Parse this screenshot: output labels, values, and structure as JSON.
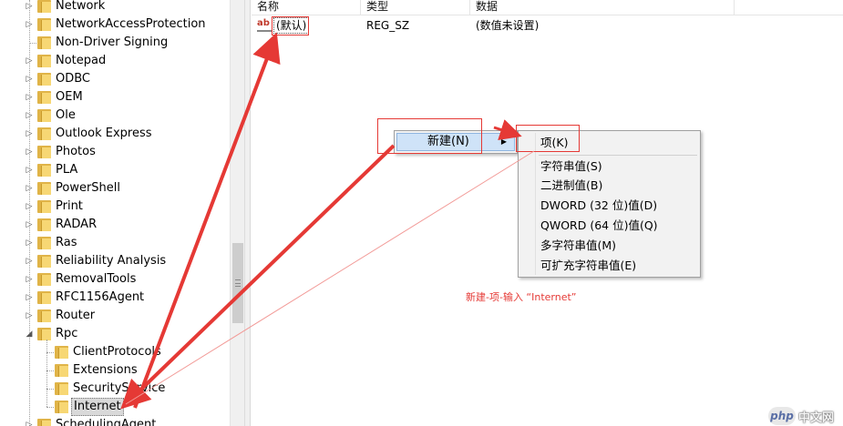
{
  "tree": {
    "items": [
      {
        "label": "Network",
        "expander": "▷",
        "level": 0
      },
      {
        "label": "NetworkAccessProtection",
        "expander": "▷",
        "level": 0
      },
      {
        "label": "Non-Driver Signing",
        "expander": "",
        "level": 0
      },
      {
        "label": "Notepad",
        "expander": "▷",
        "level": 0
      },
      {
        "label": "ODBC",
        "expander": "▷",
        "level": 0
      },
      {
        "label": "OEM",
        "expander": "▷",
        "level": 0
      },
      {
        "label": "Ole",
        "expander": "▷",
        "level": 0
      },
      {
        "label": "Outlook Express",
        "expander": "▷",
        "level": 0
      },
      {
        "label": "Photos",
        "expander": "▷",
        "level": 0
      },
      {
        "label": "PLA",
        "expander": "▷",
        "level": 0
      },
      {
        "label": "PowerShell",
        "expander": "▷",
        "level": 0
      },
      {
        "label": "Print",
        "expander": "▷",
        "level": 0
      },
      {
        "label": "RADAR",
        "expander": "▷",
        "level": 0
      },
      {
        "label": "Ras",
        "expander": "▷",
        "level": 0
      },
      {
        "label": "Reliability Analysis",
        "expander": "▷",
        "level": 0
      },
      {
        "label": "RemovalTools",
        "expander": "▷",
        "level": 0
      },
      {
        "label": "RFC1156Agent",
        "expander": "▷",
        "level": 0
      },
      {
        "label": "Router",
        "expander": "▷",
        "level": 0
      },
      {
        "label": "Rpc",
        "expander": "◢",
        "level": 0
      },
      {
        "label": "ClientProtocols",
        "expander": "",
        "level": 1
      },
      {
        "label": "Extensions",
        "expander": "",
        "level": 1
      },
      {
        "label": "SecurityService",
        "expander": "",
        "level": 1
      },
      {
        "label": "Internet",
        "expander": "",
        "level": 1,
        "selected": true
      },
      {
        "label": "SchedulingAgent",
        "expander": "▷",
        "level": 0
      }
    ]
  },
  "list": {
    "columns": [
      "名称",
      "类型",
      "数据"
    ],
    "rows": [
      {
        "icon": "ab",
        "name": "(默认)",
        "type": "REG_SZ",
        "data": "(数值未设置)"
      }
    ]
  },
  "context_menu": {
    "new_label": "新建(N)",
    "submenu_arrow": "▶"
  },
  "submenu": {
    "key_label": "项(K)",
    "items": [
      "字符串值(S)",
      "二进制值(B)",
      "DWORD (32 位)值(D)",
      "QWORD (64 位)值(Q)",
      "多字符串值(M)",
      "可扩充字符串值(E)"
    ]
  },
  "annotation": {
    "text": "新建-项-输入 “Internet”",
    "color": "#e53935"
  },
  "watermark": {
    "logo": "php",
    "text": "中文网"
  },
  "colors": {
    "folder": "#f7d774",
    "menu_highlight": "#cfe3f8",
    "annotation": "#e53935"
  }
}
